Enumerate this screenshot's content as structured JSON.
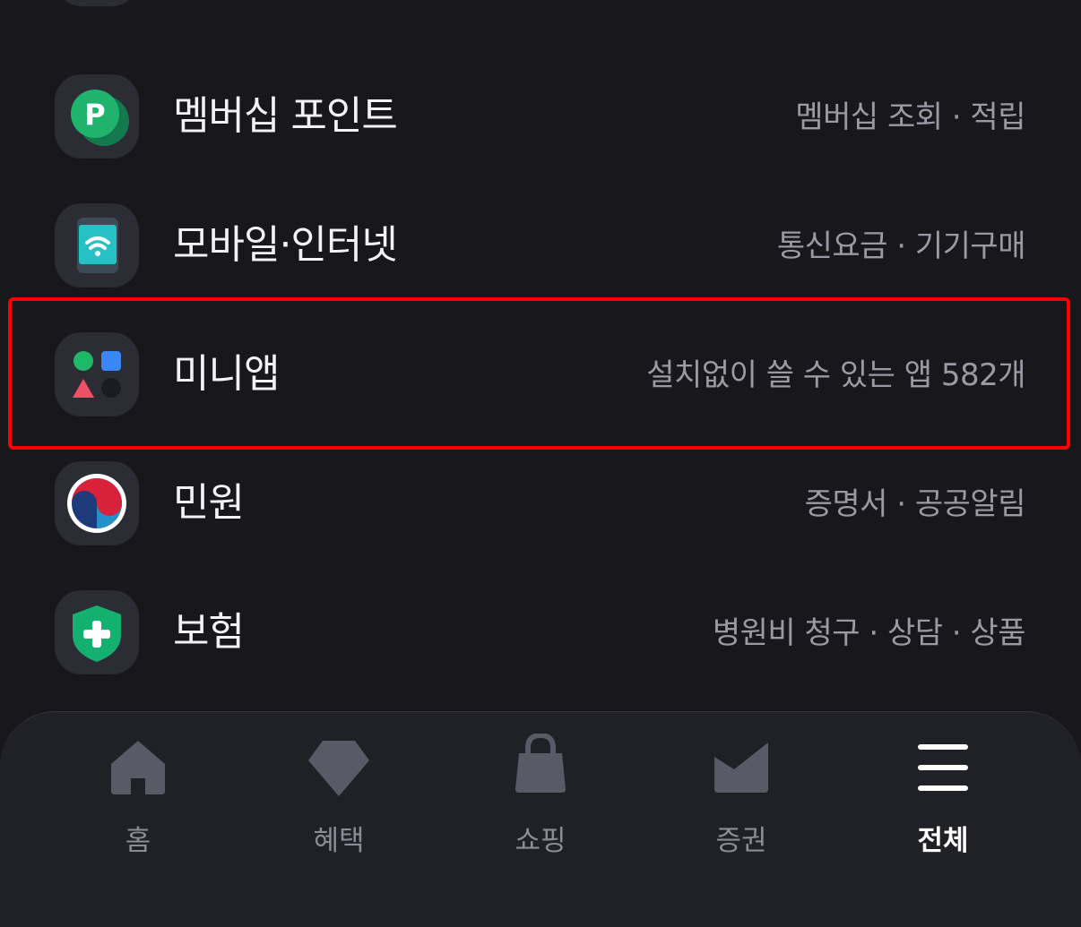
{
  "menu": [
    {
      "title": "",
      "subtitle": ""
    },
    {
      "title": "멤버십 포인트",
      "subtitle": "멤버십 조회 · 적립"
    },
    {
      "title": "모바일·인터넷",
      "subtitle": "통신요금 · 기기구매"
    },
    {
      "title": "미니앱",
      "subtitle": "설치없이 쓸 수 있는 앱 582개"
    },
    {
      "title": "민원",
      "subtitle": "증명서 · 공공알림"
    },
    {
      "title": "보험",
      "subtitle": "병원비 청구 · 상담 · 상품"
    }
  ],
  "tabs": [
    {
      "label": "홈",
      "icon": "home-icon"
    },
    {
      "label": "혜택",
      "icon": "gem-icon"
    },
    {
      "label": "쇼핑",
      "icon": "shopping-bag-icon"
    },
    {
      "label": "증권",
      "icon": "stock-chart-icon"
    },
    {
      "label": "전체",
      "icon": "menu-icon",
      "active": true
    }
  ],
  "colors": {
    "background": "#17171c",
    "icon_tile": "#2c2c35",
    "highlight": "#ff0000",
    "tab_inactive": "#5a5a66",
    "tab_active": "#ffffff"
  }
}
